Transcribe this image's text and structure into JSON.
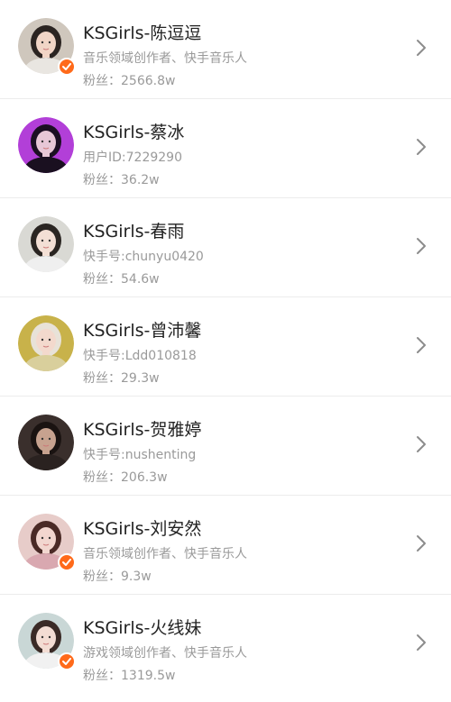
{
  "list": {
    "items": [
      {
        "name": "KSGirls-陈逗逗",
        "desc": "音乐领域创作者、快手音乐人",
        "fans": "粉丝：2566.8w",
        "verified": true,
        "avatar": {
          "bg": "#cfc7bd",
          "hair": "#2b2421",
          "skin": "#f1d5c6",
          "cloth": "#e9e6e1"
        }
      },
      {
        "name": "KSGirls-蔡冰",
        "desc": "用户ID:7229290",
        "fans": "粉丝：36.2w",
        "verified": false,
        "avatar": {
          "bg": "#b23fd8",
          "hair": "#1b0f22",
          "skin": "#e7c7d6",
          "cloth": "#1a1020"
        }
      },
      {
        "name": "KSGirls-春雨",
        "desc": "快手号:chunyu0420",
        "fans": "粉丝：54.6w",
        "verified": false,
        "avatar": {
          "bg": "#d9d9d4",
          "hair": "#2a2522",
          "skin": "#f3dfd5",
          "cloth": "#efefef"
        }
      },
      {
        "name": "KSGirls-曾沛馨",
        "desc": "快手号:Ldd010818",
        "fans": "粉丝：29.3w",
        "verified": false,
        "avatar": {
          "bg": "#c8b24a",
          "hair": "#e8e2d8",
          "skin": "#f3d9cd",
          "cloth": "#d9cf9c"
        }
      },
      {
        "name": "KSGirls-贺雅婷",
        "desc": "快手号:nushenting",
        "fans": "粉丝：206.3w",
        "verified": false,
        "avatar": {
          "bg": "#3a2f2c",
          "hair": "#1a1311",
          "skin": "#c7a28f",
          "cloth": "#2a2220"
        }
      },
      {
        "name": "KSGirls-刘安然",
        "desc": "音乐领域创作者、快手音乐人",
        "fans": "粉丝：9.3w",
        "verified": true,
        "avatar": {
          "bg": "#e7ccc9",
          "hair": "#4a2a26",
          "skin": "#f2d6cf",
          "cloth": "#d9a8b0"
        }
      },
      {
        "name": "KSGirls-火线妹",
        "desc": "游戏领域创作者、快手音乐人",
        "fans": "粉丝：1319.5w",
        "verified": true,
        "avatar": {
          "bg": "#c9d7d6",
          "hair": "#3a2a26",
          "skin": "#f3dcd3",
          "cloth": "#f1f1f1"
        }
      }
    ]
  },
  "colors": {
    "badge": "#ff6a1a",
    "chevron": "#8c8c8c"
  },
  "icons": {
    "verified": "check-badge-icon",
    "chevron": "chevron-right-icon"
  }
}
